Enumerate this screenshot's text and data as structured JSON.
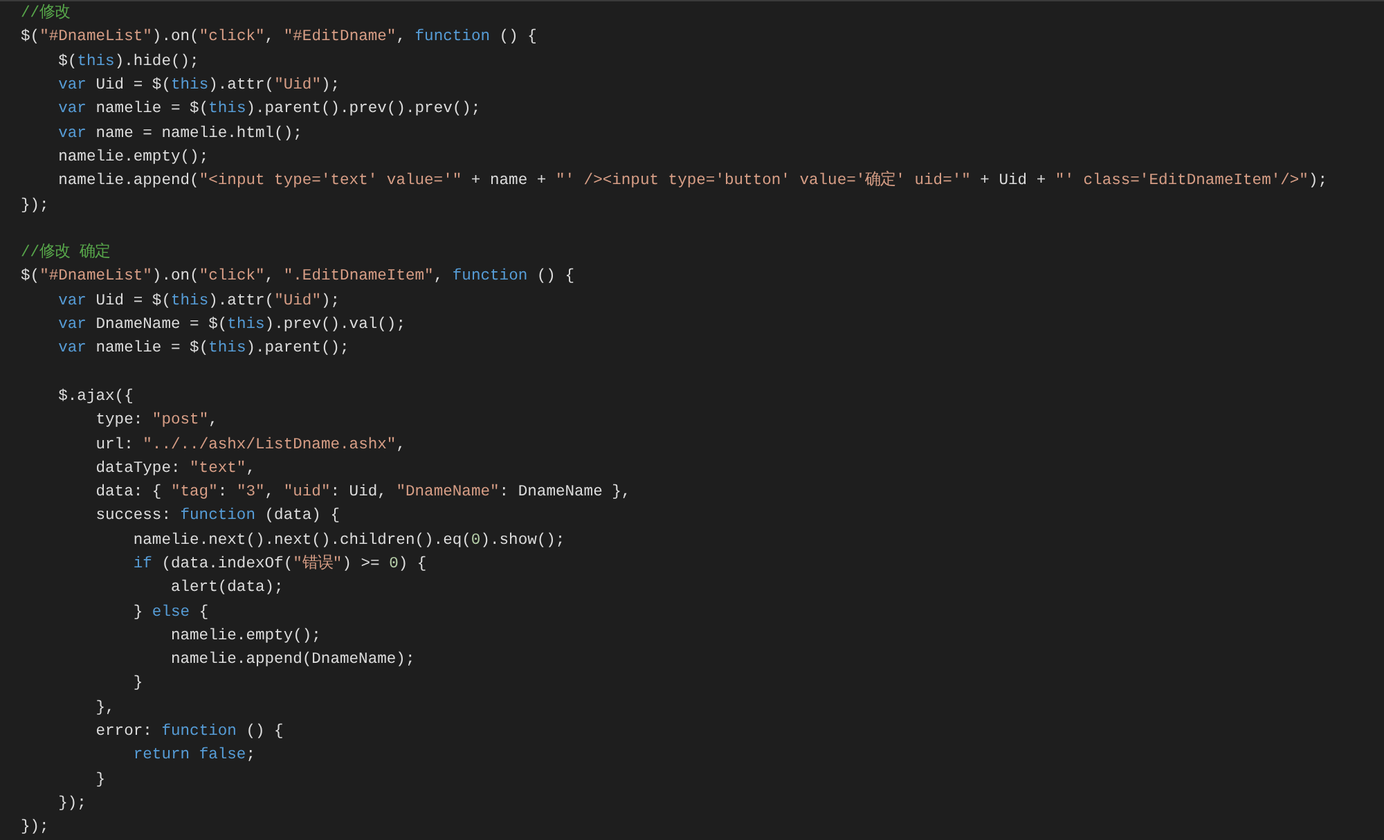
{
  "editor": {
    "lines": [
      {
        "kind": "code",
        "tokens": [
          {
            "kind": "comment",
            "text": "//修改"
          }
        ]
      },
      {
        "kind": "code",
        "tokens": [
          {
            "kind": "plain",
            "text": "$("
          },
          {
            "kind": "string",
            "text": "\"#DnameList\""
          },
          {
            "kind": "plain",
            "text": ").on("
          },
          {
            "kind": "string",
            "text": "\"click\""
          },
          {
            "kind": "plain",
            "text": ", "
          },
          {
            "kind": "string",
            "text": "\"#EditDname\""
          },
          {
            "kind": "plain",
            "text": ", "
          },
          {
            "kind": "keyword",
            "text": "function"
          },
          {
            "kind": "plain",
            "text": " () {"
          }
        ]
      },
      {
        "kind": "code",
        "tokens": [
          {
            "kind": "plain",
            "text": "    $("
          },
          {
            "kind": "keyword",
            "text": "this"
          },
          {
            "kind": "plain",
            "text": ").hide();"
          }
        ]
      },
      {
        "kind": "code",
        "tokens": [
          {
            "kind": "keyword",
            "text": "    var"
          },
          {
            "kind": "plain",
            "text": " Uid = $("
          },
          {
            "kind": "keyword",
            "text": "this"
          },
          {
            "kind": "plain",
            "text": ").attr("
          },
          {
            "kind": "string",
            "text": "\"Uid\""
          },
          {
            "kind": "plain",
            "text": ");"
          }
        ]
      },
      {
        "kind": "code",
        "tokens": [
          {
            "kind": "keyword",
            "text": "    var"
          },
          {
            "kind": "plain",
            "text": " namelie = $("
          },
          {
            "kind": "keyword",
            "text": "this"
          },
          {
            "kind": "plain",
            "text": ").parent().prev().prev();"
          }
        ]
      },
      {
        "kind": "code",
        "tokens": [
          {
            "kind": "keyword",
            "text": "    var"
          },
          {
            "kind": "plain",
            "text": " name = namelie.html();"
          }
        ]
      },
      {
        "kind": "code",
        "tokens": [
          {
            "kind": "plain",
            "text": "    namelie.empty();"
          }
        ]
      },
      {
        "kind": "code",
        "tokens": [
          {
            "kind": "plain",
            "text": "    namelie.append("
          },
          {
            "kind": "string",
            "text": "\"<input type='text' value='\""
          },
          {
            "kind": "plain",
            "text": " + name + "
          },
          {
            "kind": "string",
            "text": "\"' /><input type='button' value='确定' uid='\""
          },
          {
            "kind": "plain",
            "text": " + Uid + "
          },
          {
            "kind": "string",
            "text": "\"' class='EditDnameItem'/>\""
          },
          {
            "kind": "plain",
            "text": ");"
          }
        ]
      },
      {
        "kind": "code",
        "tokens": [
          {
            "kind": "plain",
            "text": "});"
          }
        ]
      },
      {
        "kind": "blank"
      },
      {
        "kind": "code",
        "tokens": [
          {
            "kind": "comment",
            "text": "//修改 确定"
          }
        ]
      },
      {
        "kind": "code",
        "tokens": [
          {
            "kind": "plain",
            "text": "$("
          },
          {
            "kind": "string",
            "text": "\"#DnameList\""
          },
          {
            "kind": "plain",
            "text": ").on("
          },
          {
            "kind": "string",
            "text": "\"click\""
          },
          {
            "kind": "plain",
            "text": ", "
          },
          {
            "kind": "string",
            "text": "\".EditDnameItem\""
          },
          {
            "kind": "plain",
            "text": ", "
          },
          {
            "kind": "keyword",
            "text": "function"
          },
          {
            "kind": "plain",
            "text": " () {"
          }
        ]
      },
      {
        "kind": "code",
        "tokens": [
          {
            "kind": "keyword",
            "text": "    var"
          },
          {
            "kind": "plain",
            "text": " Uid = $("
          },
          {
            "kind": "keyword",
            "text": "this"
          },
          {
            "kind": "plain",
            "text": ").attr("
          },
          {
            "kind": "string",
            "text": "\"Uid\""
          },
          {
            "kind": "plain",
            "text": ");"
          }
        ]
      },
      {
        "kind": "code",
        "tokens": [
          {
            "kind": "keyword",
            "text": "    var"
          },
          {
            "kind": "plain",
            "text": " DnameName = $("
          },
          {
            "kind": "keyword",
            "text": "this"
          },
          {
            "kind": "plain",
            "text": ").prev().val();"
          }
        ]
      },
      {
        "kind": "code",
        "tokens": [
          {
            "kind": "keyword",
            "text": "    var"
          },
          {
            "kind": "plain",
            "text": " namelie = $("
          },
          {
            "kind": "keyword",
            "text": "this"
          },
          {
            "kind": "plain",
            "text": ").parent();"
          }
        ]
      },
      {
        "kind": "blank"
      },
      {
        "kind": "code",
        "tokens": [
          {
            "kind": "plain",
            "text": "    $.ajax({"
          }
        ]
      },
      {
        "kind": "code",
        "tokens": [
          {
            "kind": "plain",
            "text": "        type: "
          },
          {
            "kind": "string",
            "text": "\"post\""
          },
          {
            "kind": "plain",
            "text": ","
          }
        ]
      },
      {
        "kind": "code",
        "tokens": [
          {
            "kind": "plain",
            "text": "        url: "
          },
          {
            "kind": "string",
            "text": "\"../../ashx/ListDname.ashx\""
          },
          {
            "kind": "plain",
            "text": ","
          }
        ]
      },
      {
        "kind": "code",
        "tokens": [
          {
            "kind": "plain",
            "text": "        dataType: "
          },
          {
            "kind": "string",
            "text": "\"text\""
          },
          {
            "kind": "plain",
            "text": ","
          }
        ]
      },
      {
        "kind": "code",
        "tokens": [
          {
            "kind": "plain",
            "text": "        data: { "
          },
          {
            "kind": "string",
            "text": "\"tag\""
          },
          {
            "kind": "plain",
            "text": ": "
          },
          {
            "kind": "string",
            "text": "\"3\""
          },
          {
            "kind": "plain",
            "text": ", "
          },
          {
            "kind": "string",
            "text": "\"uid\""
          },
          {
            "kind": "plain",
            "text": ": Uid, "
          },
          {
            "kind": "string",
            "text": "\"DnameName\""
          },
          {
            "kind": "plain",
            "text": ": DnameName },"
          }
        ]
      },
      {
        "kind": "code",
        "tokens": [
          {
            "kind": "plain",
            "text": "        success: "
          },
          {
            "kind": "keyword",
            "text": "function"
          },
          {
            "kind": "plain",
            "text": " (data) {"
          }
        ]
      },
      {
        "kind": "code",
        "tokens": [
          {
            "kind": "plain",
            "text": "            namelie.next().next().children().eq("
          },
          {
            "kind": "number",
            "text": "0"
          },
          {
            "kind": "plain",
            "text": ").show();"
          }
        ]
      },
      {
        "kind": "code",
        "tokens": [
          {
            "kind": "keyword",
            "text": "            if"
          },
          {
            "kind": "plain",
            "text": " (data.indexOf("
          },
          {
            "kind": "string",
            "text": "\"错误\""
          },
          {
            "kind": "plain",
            "text": ") >= "
          },
          {
            "kind": "number",
            "text": "0"
          },
          {
            "kind": "plain",
            "text": ") {"
          }
        ]
      },
      {
        "kind": "code",
        "tokens": [
          {
            "kind": "plain",
            "text": "                alert(data);"
          }
        ]
      },
      {
        "kind": "code",
        "tokens": [
          {
            "kind": "plain",
            "text": "            } "
          },
          {
            "kind": "keyword",
            "text": "else"
          },
          {
            "kind": "plain",
            "text": " {"
          }
        ]
      },
      {
        "kind": "code",
        "tokens": [
          {
            "kind": "plain",
            "text": "                namelie.empty();"
          }
        ]
      },
      {
        "kind": "code",
        "tokens": [
          {
            "kind": "plain",
            "text": "                namelie.append(DnameName);"
          }
        ]
      },
      {
        "kind": "code",
        "tokens": [
          {
            "kind": "plain",
            "text": "            }"
          }
        ]
      },
      {
        "kind": "code",
        "tokens": [
          {
            "kind": "plain",
            "text": "        },"
          }
        ]
      },
      {
        "kind": "code",
        "tokens": [
          {
            "kind": "plain",
            "text": "        error: "
          },
          {
            "kind": "keyword",
            "text": "function"
          },
          {
            "kind": "plain",
            "text": " () {"
          }
        ]
      },
      {
        "kind": "code",
        "tokens": [
          {
            "kind": "keyword",
            "text": "            return false"
          },
          {
            "kind": "plain",
            "text": ";"
          }
        ]
      },
      {
        "kind": "code",
        "tokens": [
          {
            "kind": "plain",
            "text": "        }"
          }
        ]
      },
      {
        "kind": "code",
        "tokens": [
          {
            "kind": "plain",
            "text": "    });"
          }
        ]
      },
      {
        "kind": "code",
        "tokens": [
          {
            "kind": "plain",
            "text": "});"
          }
        ]
      }
    ]
  }
}
